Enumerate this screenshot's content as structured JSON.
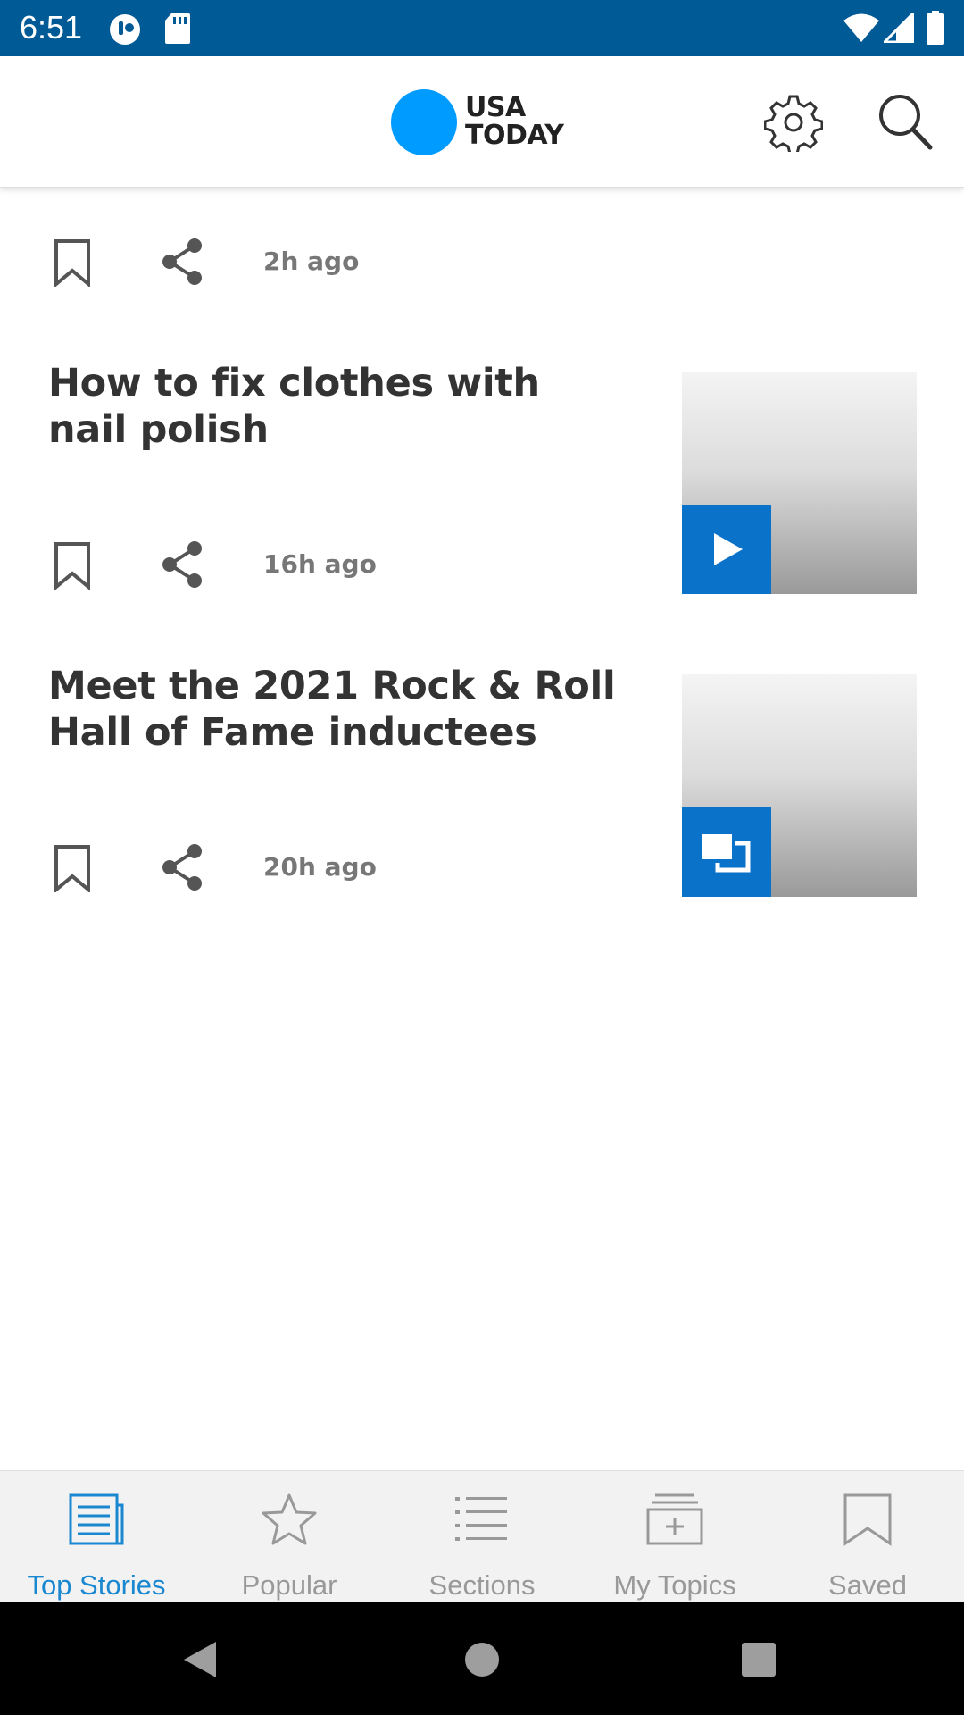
{
  "status_bar": {
    "time": "6:51"
  },
  "header": {
    "logo_line1": "USA",
    "logo_line2": "TODAY"
  },
  "feed": {
    "items": [
      {
        "time": "2h ago"
      },
      {
        "title": "How to fix clothes with nail polish",
        "time": "16h ago",
        "badge": "play-icon"
      },
      {
        "title": "Meet the 2021 Rock & Roll Hall of Fame inductees",
        "time": "20h ago",
        "badge": "gallery-icon"
      }
    ]
  },
  "bottom_nav": {
    "items": [
      {
        "label": "Top Stories",
        "icon": "newspaper-icon",
        "active": true
      },
      {
        "label": "Popular",
        "icon": "star-icon"
      },
      {
        "label": "Sections",
        "icon": "list-icon"
      },
      {
        "label": "My Topics",
        "icon": "topics-icon"
      },
      {
        "label": "Saved",
        "icon": "bookmark-icon"
      }
    ]
  },
  "colors": {
    "status_bar": "#005a96",
    "logo_blue": "#009bff",
    "accent": "#1a88d0",
    "badge": "#0a72c8"
  }
}
